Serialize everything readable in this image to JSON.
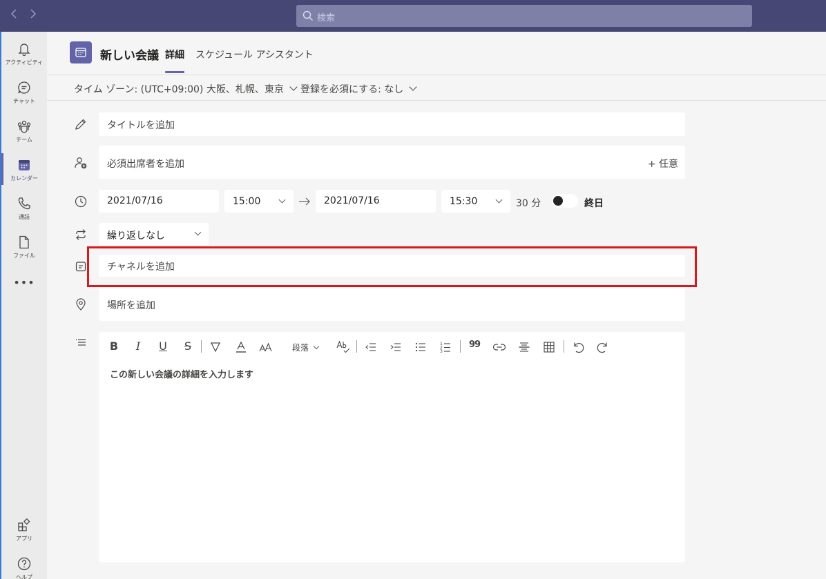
{
  "topbar": {
    "back_icon": "chevron-left-icon",
    "forward_icon": "chevron-right-icon",
    "search_placeholder": "検索"
  },
  "rail": {
    "items": [
      {
        "label": "アクティビティ",
        "icon": "bell-icon"
      },
      {
        "label": "チャット",
        "icon": "chat-icon"
      },
      {
        "label": "チーム",
        "icon": "teams-icon"
      },
      {
        "label": "カレンダー",
        "icon": "calendar-icon",
        "active": true
      },
      {
        "label": "通話",
        "icon": "phone-icon"
      },
      {
        "label": "ファイル",
        "icon": "file-icon"
      }
    ],
    "more": "•••",
    "bottom_items": [
      {
        "label": "アプリ",
        "icon": "apps-icon"
      },
      {
        "label": "ヘルプ",
        "icon": "help-icon"
      }
    ]
  },
  "header": {
    "title": "新しい会議",
    "tabs": [
      {
        "label": "詳細",
        "active": true
      },
      {
        "label": "スケジュール アシスタント",
        "active": false
      }
    ]
  },
  "subheader": {
    "timezone": "タイム ゾーン: (UTC+09:00) 大阪、札幌、東京",
    "registration": "登録を必須にする: なし"
  },
  "form": {
    "title_placeholder": "タイトルを追加",
    "attendees_placeholder": "必須出席者を追加",
    "optional_label": "+ 任意",
    "start_date": "2021/07/16",
    "start_time": "15:00",
    "end_date": "2021/07/16",
    "end_time": "15:30",
    "duration": "30 分",
    "all_day_label": "終日",
    "all_day_on": false,
    "repeat": "繰り返しなし",
    "channel_placeholder": "チャネルを追加",
    "location_placeholder": "場所を追加",
    "arrow": "→"
  },
  "editor": {
    "toolbar": {
      "bold": "B",
      "italic": "I",
      "underline": "U",
      "strike": "S",
      "paragraph": "段落",
      "quote": "99"
    },
    "placeholder": "この新しい会議の詳細を入力します"
  },
  "colors": {
    "topbar": "#464775",
    "accent": "#6264a7",
    "highlight": "#d7191c"
  }
}
